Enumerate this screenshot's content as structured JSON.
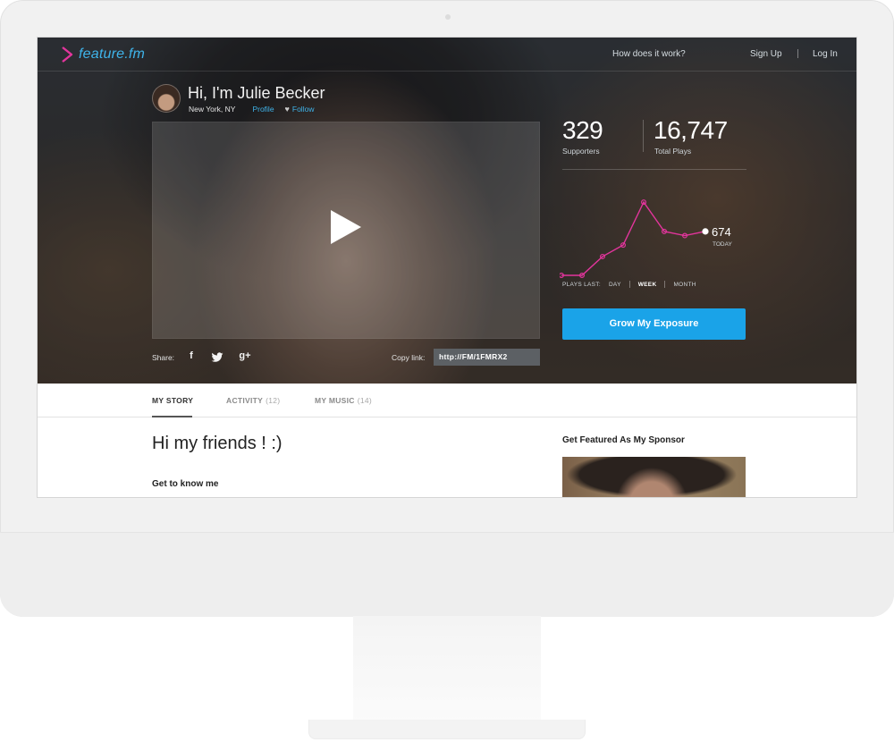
{
  "nav": {
    "logo": "feature.fm",
    "how": "How does it work?",
    "signup": "Sign Up",
    "login": "Log In"
  },
  "profile": {
    "greeting": "Hi, I'm Julie Becker",
    "location": "New York, NY",
    "profile_link": "Profile",
    "follow_link": "Follow"
  },
  "share": {
    "label": "Share:",
    "facebook": "f",
    "googleplus": "g+",
    "copy_label": "Copy link:",
    "copy_value": "http://FM/1FMRX2"
  },
  "stats": {
    "supporters": "329",
    "supporters_label": "Supporters",
    "plays": "16,747",
    "plays_label": "Total Plays"
  },
  "chart": {
    "today_value": "674",
    "today_label": "TODAY",
    "period_label": "PLAYS LAST:",
    "periods": [
      "DAY",
      "WEEK",
      "MONTH"
    ],
    "active_period": "WEEK"
  },
  "chart_data": {
    "type": "line",
    "series": [
      {
        "values": [
          0,
          0,
          18,
          29,
          70,
          42,
          38,
          42
        ]
      }
    ],
    "color": "#e2359c",
    "grid": false
  },
  "cta": {
    "label": "Grow My Exposure"
  },
  "tabs": [
    {
      "label": "MY STORY",
      "count": ""
    },
    {
      "label": "ACTIVITY",
      "count": "(12)"
    },
    {
      "label": "MY MUSIC",
      "count": "(14)"
    }
  ],
  "story": {
    "title": "Hi my friends ! :)",
    "subtitle": "Get to know me"
  },
  "sponsor": {
    "title": "Get Featured As My Sponsor"
  },
  "colors": {
    "accent": "#1aa3e8",
    "logo": "#3fb4ea",
    "chart_line": "#e2359c"
  }
}
